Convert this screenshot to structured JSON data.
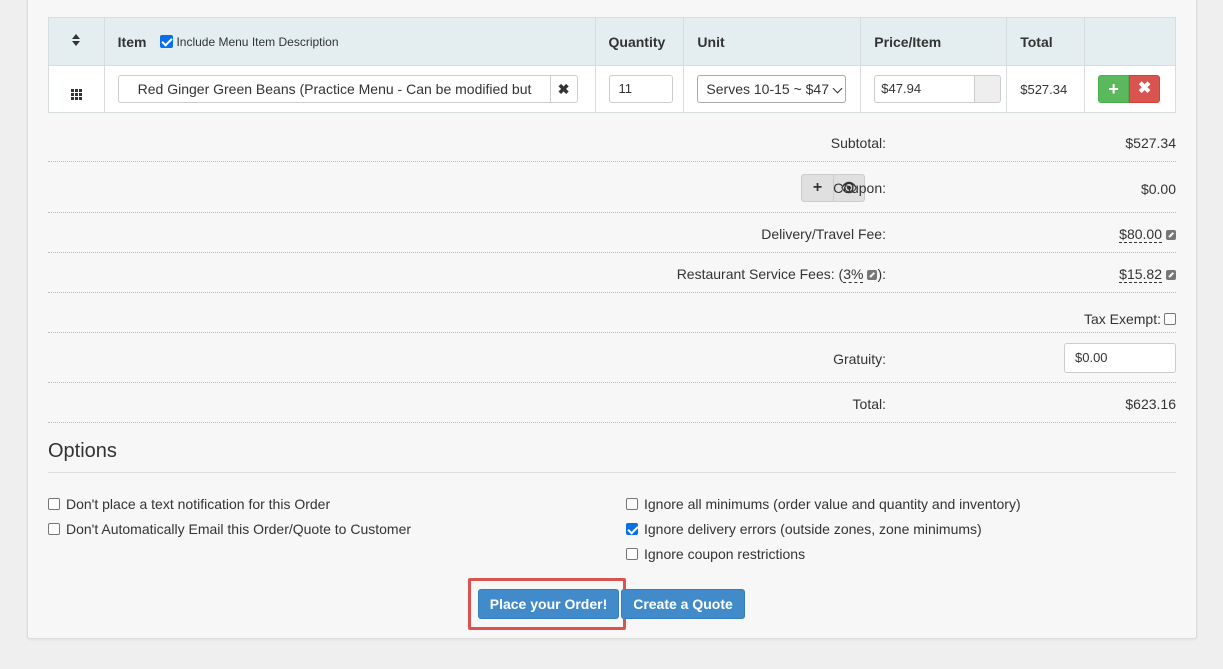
{
  "table": {
    "headers": {
      "item": "Item",
      "include_desc": "Include Menu Item Description",
      "quantity": "Quantity",
      "unit": "Unit",
      "price": "Price/Item",
      "total": "Total"
    },
    "include_desc_checked": true,
    "row": {
      "item_value": "Red Ginger Green Beans (Practice Menu - Can be modified but",
      "clear_icon": "✖",
      "quantity": "11",
      "unit": "Serves 10-15 ~ $47",
      "price": "$47.94",
      "total": "$527.34",
      "add_icon": "+",
      "delete_icon": "✖"
    }
  },
  "totals": {
    "subtotal_label": "Subtotal:",
    "subtotal_value": "$527.34",
    "coupon_label": "Coupon:",
    "coupon_value": "$0.00",
    "coupon_add_icon": "+",
    "coupon_view_icon": "👁",
    "delivery_label": "Delivery/Travel Fee:",
    "delivery_value": "$80.00",
    "service_label_prefix": "Restaurant Service Fees: (",
    "service_pct": "3%",
    "service_label_suffix": "):",
    "service_value": "$15.82",
    "tax_exempt_label": "Tax Exempt:",
    "gratuity_label": "Gratuity:",
    "gratuity_value": "$0.00",
    "total_label": "Total:",
    "total_value": "$623.16"
  },
  "options": {
    "title": "Options",
    "left": [
      {
        "label": "Don't place a text notification for this Order",
        "checked": false
      },
      {
        "label": "Don't Automatically Email this Order/Quote to Customer",
        "checked": false
      }
    ],
    "right": [
      {
        "label": "Ignore all minimums (order value and quantity and inventory)",
        "checked": false
      },
      {
        "label": "Ignore delivery errors (outside zones, zone minimums)",
        "checked": true
      },
      {
        "label": "Ignore coupon restrictions",
        "checked": false
      }
    ]
  },
  "actions": {
    "place_order": "Place your Order!",
    "create_quote": "Create a Quote"
  },
  "colors": {
    "primary": "#428bca",
    "success": "#5cb85c",
    "danger": "#d9534f",
    "header_bg": "#e4eef1"
  }
}
